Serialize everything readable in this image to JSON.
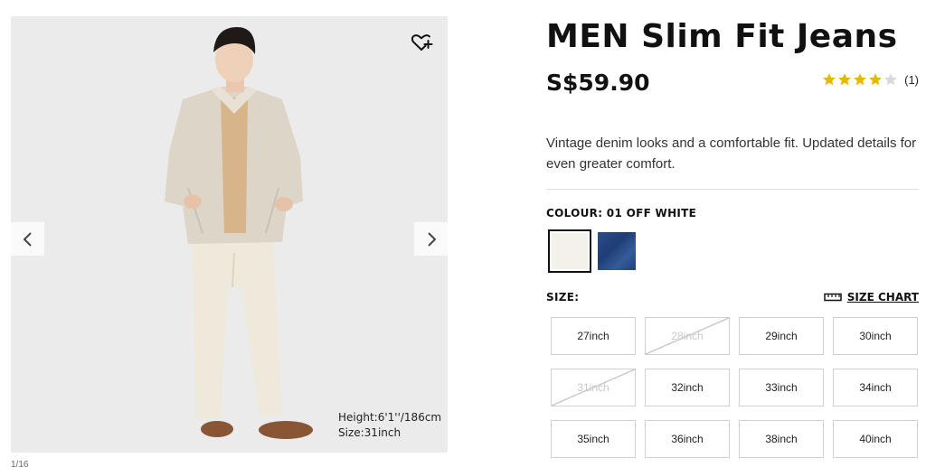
{
  "product": {
    "title": "MEN Slim Fit Jeans",
    "price": "S$59.90",
    "rating": {
      "stars": 4,
      "max": 5,
      "count_text": "(1)"
    },
    "description": "Vintage denim looks and a comfortable fit. Updated details for even greater comfort."
  },
  "gallery": {
    "model_height": "Height:6'1''/186cm",
    "model_size": "Size:31inch",
    "counter": "1/16",
    "icons": {
      "wishlist": "heart-plus-icon",
      "prev": "chevron-left-icon",
      "next": "chevron-right-icon"
    }
  },
  "colour": {
    "label": "COLOUR: 01 OFF WHITE",
    "options": [
      {
        "name": "01 OFF WHITE",
        "color": "#f4f1ea",
        "selected": true
      },
      {
        "name": "BLUE",
        "color": "#2a4a86",
        "selected": false
      }
    ]
  },
  "size": {
    "label": "SIZE:",
    "chart_label": "SIZE CHART",
    "chart_icon": "ruler-icon",
    "options": [
      {
        "label": "27inch",
        "available": true
      },
      {
        "label": "28inch",
        "available": false
      },
      {
        "label": "29inch",
        "available": true
      },
      {
        "label": "30inch",
        "available": true
      },
      {
        "label": "31inch",
        "available": false
      },
      {
        "label": "32inch",
        "available": true
      },
      {
        "label": "33inch",
        "available": true
      },
      {
        "label": "34inch",
        "available": true
      },
      {
        "label": "35inch",
        "available": true
      },
      {
        "label": "36inch",
        "available": true
      },
      {
        "label": "38inch",
        "available": true
      },
      {
        "label": "40inch",
        "available": true
      }
    ]
  },
  "colors": {
    "star_filled": "#e6b800",
    "star_empty": "#d9d9d9",
    "text": "#111111"
  }
}
